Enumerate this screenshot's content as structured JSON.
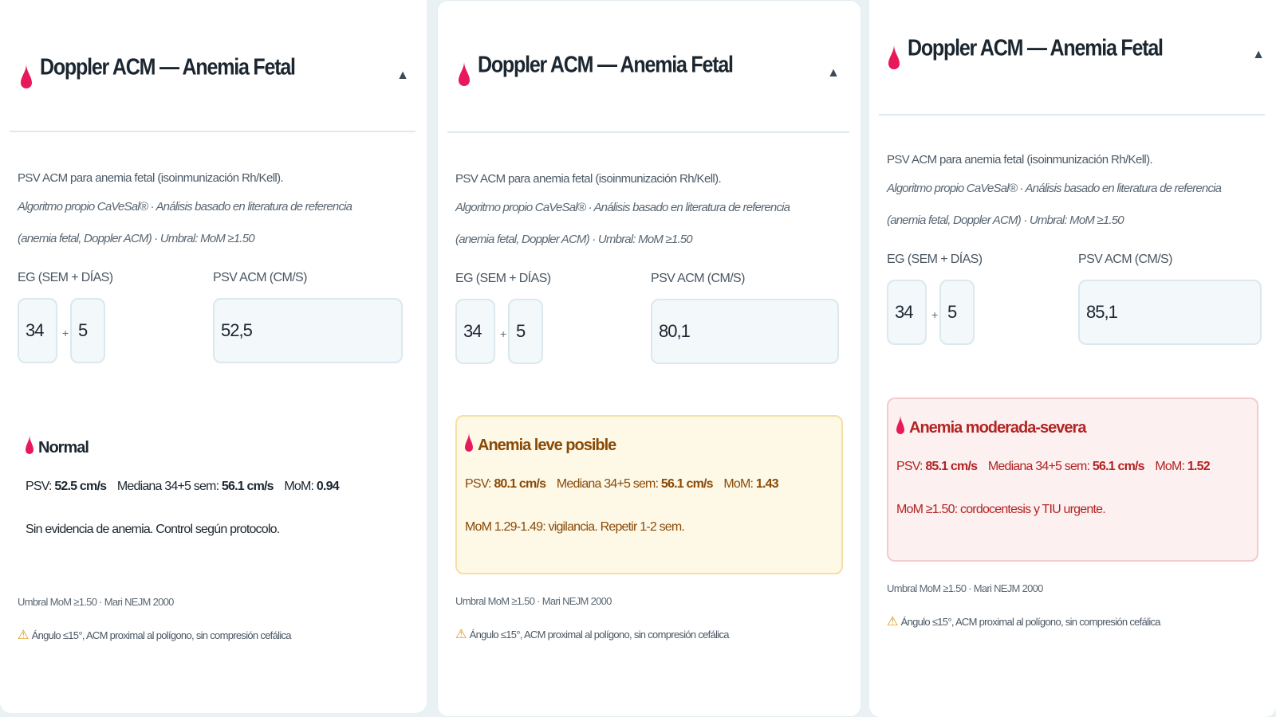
{
  "colors": {
    "accent_drop": "#e8195a",
    "normal_text": "#1b2630",
    "mild_bg": "#fef8e7",
    "mild_text": "#8a4a07",
    "severe_bg": "#fdf0f0",
    "severe_text": "#b32323"
  },
  "common": {
    "title": "Doppler ACM — Anemia Fetal",
    "collapse_icon": "▲",
    "description": "PSV ACM para anemia fetal (isoinmunización Rh/Kell).",
    "algorithm": "Algoritmo propio CaVeSal® · Análisis basado en literatura de referencia (anemia fetal, Doppler ACM) · Umbral: MoM ≥1.50",
    "label_eg": "EG (sem + días)",
    "label_psv": "PSV ACM (cm/s)",
    "plus": "+",
    "footer_ref": "Umbral MoM ≥1.50 · Mari NEJM 2000",
    "warning_icon": "⚠",
    "warning_text": "Ángulo ≤15°, ACM proximal al polígono, sin compresión cefálica",
    "psv_label": "PSV:",
    "median_label": "Mediana 34+5 sem:",
    "mom_label": "MoM:"
  },
  "cards": [
    {
      "weeks": "34",
      "days": "5",
      "psv_input": "52,5",
      "result_title": "Normal",
      "psv_value": "52.5 cm/s",
      "median_value": "56.1 cm/s",
      "mom_value": "0.94",
      "message": "Sin evidencia de anemia. Control según protocolo."
    },
    {
      "weeks": "34",
      "days": "5",
      "psv_input": "80,1",
      "result_title": "Anemia leve posible",
      "psv_value": "80.1 cm/s",
      "median_value": "56.1 cm/s",
      "mom_value": "1.43",
      "message": "MoM 1.29-1.49: vigilancia. Repetir 1-2 sem."
    },
    {
      "weeks": "34",
      "days": "5",
      "psv_input": "85,1",
      "result_title": "Anemia moderada-severa",
      "psv_value": "85.1 cm/s",
      "median_value": "56.1 cm/s",
      "mom_value": "1.52",
      "message": "MoM ≥1.50: cordocentesis y TIU urgente."
    }
  ]
}
